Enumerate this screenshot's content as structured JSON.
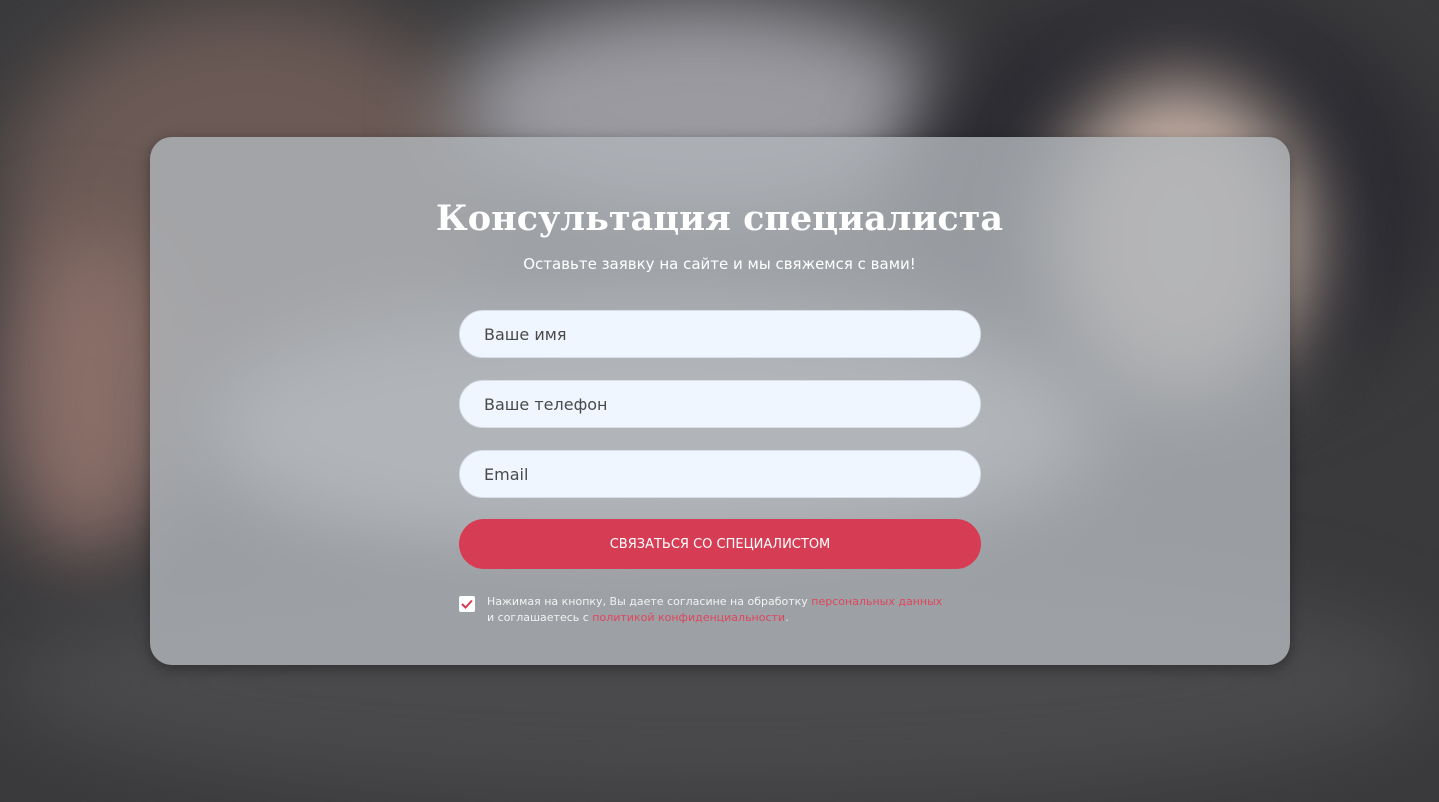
{
  "form": {
    "title": "Консультация специалиста",
    "subtitle": "Оставьте заявку на сайте и мы свяжемся с вами!",
    "name_placeholder": "Ваше имя",
    "phone_placeholder": "Ваше телефон",
    "email_placeholder": "Email",
    "submit_label": "Связаться со специалистом",
    "consent_checked": true,
    "consent_text_1": "Нажимая на кнопку, Вы даете согласине на обработку ",
    "consent_link_1": "персональных данных",
    "consent_text_2": " и соглашаетесь с ",
    "consent_link_2": "политикой конфиденциальности",
    "consent_text_3": "."
  },
  "colors": {
    "accent": "#d63d55",
    "input_bg": "#eff6ff"
  }
}
